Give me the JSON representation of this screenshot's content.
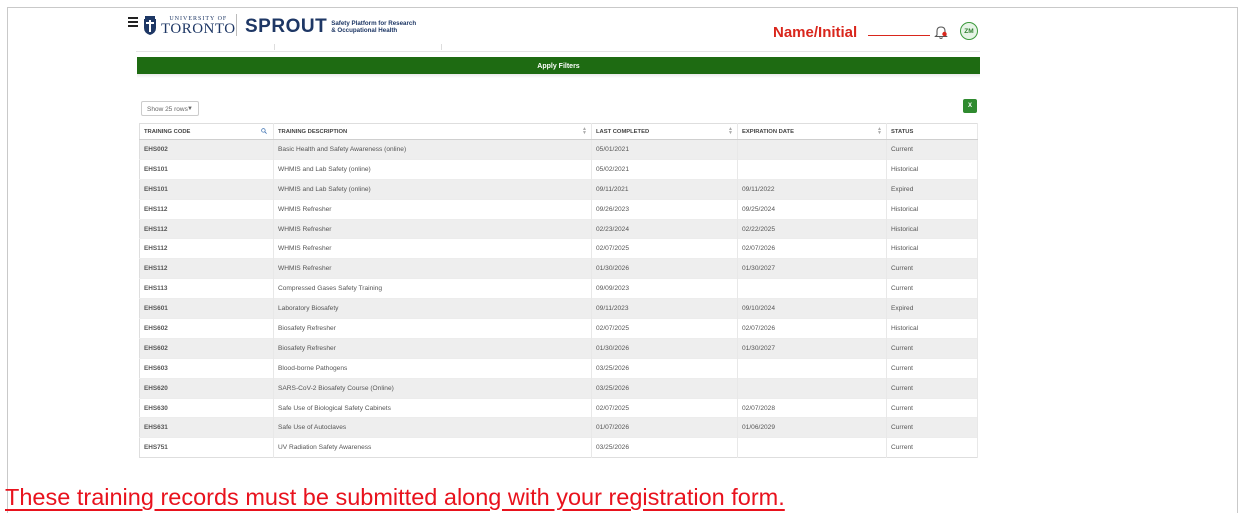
{
  "header": {
    "university_small": "UNIVERSITY OF",
    "university_big": "TORONTO",
    "app_name": "SPROUT",
    "app_tagline_1": "Safety Platform for Research",
    "app_tagline_2": "& Occupational Health",
    "avatar_initials": "ZM",
    "annotation_label": "Name/Initial"
  },
  "filters": {
    "apply_label": "Apply Filters"
  },
  "toolbar": {
    "rows_select_value": "Show 25 rows",
    "export_icon_text": "X"
  },
  "table": {
    "columns": [
      "TRAINING CODE",
      "TRAINING DESCRIPTION",
      "LAST COMPLETED",
      "EXPIRATION DATE",
      "STATUS"
    ],
    "rows": [
      [
        "EHS002",
        "Basic Health and Safety Awareness (online)",
        "05/01/2021",
        "",
        "Current"
      ],
      [
        "EHS101",
        "WHMIS and Lab Safety (online)",
        "05/02/2021",
        "",
        "Historical"
      ],
      [
        "EHS101",
        "WHMIS and Lab Safety (online)",
        "09/11/2021",
        "09/11/2022",
        "Expired"
      ],
      [
        "EHS112",
        "WHMIS Refresher",
        "09/26/2023",
        "09/25/2024",
        "Historical"
      ],
      [
        "EHS112",
        "WHMIS Refresher",
        "02/23/2024",
        "02/22/2025",
        "Historical"
      ],
      [
        "EHS112",
        "WHMIS Refresher",
        "02/07/2025",
        "02/07/2026",
        "Historical"
      ],
      [
        "EHS112",
        "WHMIS Refresher",
        "01/30/2026",
        "01/30/2027",
        "Current"
      ],
      [
        "EHS113",
        "Compressed Gases Safety Training",
        "09/09/2023",
        "",
        "Current"
      ],
      [
        "EHS601",
        "Laboratory Biosafety",
        "09/11/2023",
        "09/10/2024",
        "Expired"
      ],
      [
        "EHS602",
        "Biosafety Refresher",
        "02/07/2025",
        "02/07/2026",
        "Historical"
      ],
      [
        "EHS602",
        "Biosafety Refresher",
        "01/30/2026",
        "01/30/2027",
        "Current"
      ],
      [
        "EHS603",
        "Blood-borne Pathogens",
        "03/25/2026",
        "",
        "Current"
      ],
      [
        "EHS620",
        "SARS-CoV-2 Biosafety Course (Online)",
        "03/25/2026",
        "",
        "Current"
      ],
      [
        "EHS630",
        "Safe Use of Biological Safety Cabinets",
        "02/07/2025",
        "02/07/2028",
        "Current"
      ],
      [
        "EHS631",
        "Safe Use of Autoclaves",
        "01/07/2026",
        "01/06/2029",
        "Current"
      ],
      [
        "EHS751",
        "UV Radiation Safety Awareness",
        "03/25/2026",
        "",
        "Current"
      ]
    ]
  },
  "footnote": "These training records must be submitted along with your registration form.",
  "colors": {
    "brand_navy": "#1e3765",
    "apply_green": "#1e6b12",
    "annotation_red": "#d9261c"
  },
  "icons": [
    "menu-icon",
    "crest-icon",
    "bell-icon",
    "search-icon",
    "excel-export-icon"
  ]
}
